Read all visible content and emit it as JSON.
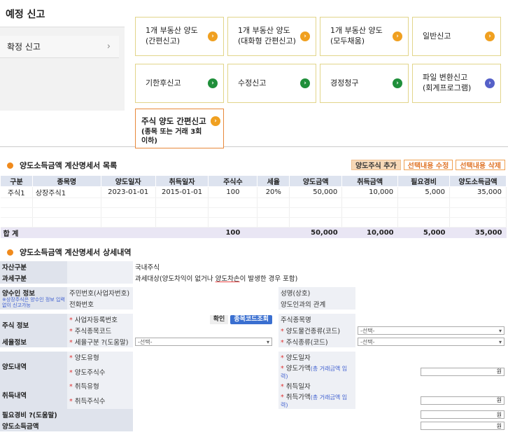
{
  "top": {
    "title": "예정 신고",
    "side_item": "확정 신고",
    "cards": [
      {
        "line1": "1개 부동산 양도",
        "line2": "(간편신고)",
        "dot": "orange"
      },
      {
        "line1": "1개 부동산 양도",
        "line2": "(대화형 간편신고)",
        "dot": "orange"
      },
      {
        "line1": "1개 부동산 양도",
        "line2": "(모두채움)",
        "dot": "orange"
      },
      {
        "line1": "일반신고",
        "line2": "",
        "dot": "orange"
      },
      {
        "line1": "기한후신고",
        "line2": "",
        "dot": "green"
      },
      {
        "line1": "수정신고",
        "line2": "",
        "dot": "green"
      },
      {
        "line1": "경정청구",
        "line2": "",
        "dot": "green"
      },
      {
        "line1": "파일 변환신고",
        "line2": "(회계프로그램)",
        "dot": "blue"
      }
    ],
    "selected_card": {
      "line1": "주식 양도 간편신고",
      "line2": "(종목 또는 거래 3회 이하)"
    }
  },
  "list": {
    "title": "양도소득금액 계산명세서 목록",
    "buttons": {
      "add": "양도주식 추가",
      "edit": "선택내용 수정",
      "delete": "선택내용 삭제"
    },
    "columns": [
      "구분",
      "종목명",
      "양도일자",
      "취득일자",
      "주식수",
      "세율",
      "양도금액",
      "취득금액",
      "필요경비",
      "양도소득금액"
    ],
    "rows": [
      [
        "주식1",
        "상장주식1",
        "2023-01-01",
        "2015-01-01",
        "100",
        "20%",
        "50,000",
        "10,000",
        "5,000",
        "35,000"
      ]
    ],
    "sum": {
      "label": "합  계",
      "qty": "100",
      "sale": "50,000",
      "acq": "10,000",
      "exp": "5,000",
      "income": "35,000"
    }
  },
  "detail": {
    "title": "양도소득금액 계산명세서 상세내역",
    "asset_label": "자산구분",
    "asset_value": "국내주식",
    "tax_label": "과세구분",
    "tax_value_a": "과세대상(양도차익이 없거나 ",
    "tax_value_u": "양도차손",
    "tax_value_b": "이 발생한 경우 포함)",
    "transferee": {
      "label": "양수인 정보",
      "note": "※상장주식은 양수인 정보 입력 없이 신고가능",
      "rrn": "주민번호(사업자번호)",
      "phone": "전화번호",
      "name": "성명(상호)",
      "relation": "양도인과의 관계"
    },
    "stock": {
      "label": "주식 정보",
      "bizno": "사업자등록번호",
      "confirm": "확인",
      "search": "종목코드조회",
      "stockname": "주식종목명",
      "code": "주식종목코드",
      "qual": "양도물건종류(코드)",
      "kind": "주식종류(코드)",
      "select": "-선택-"
    },
    "rate": {
      "label": "세율정보",
      "rate_code": "세율구분 ?(도움말)"
    },
    "sale": {
      "label": "양도내역",
      "type": "양도유형",
      "date": "양도일자",
      "qty": "양도주식수",
      "price": "양도가액",
      "price_help": "(총 거래금액 입력)"
    },
    "acq": {
      "label": "취득내역",
      "type": "취득유형",
      "date": "취득일자",
      "qty": "취득주식수",
      "price": "취득가액",
      "price_help": "(총 거래금액 입력)"
    },
    "expense": "필요경비 ?(도움말)",
    "income": "양도소득금액",
    "unit": "원"
  }
}
